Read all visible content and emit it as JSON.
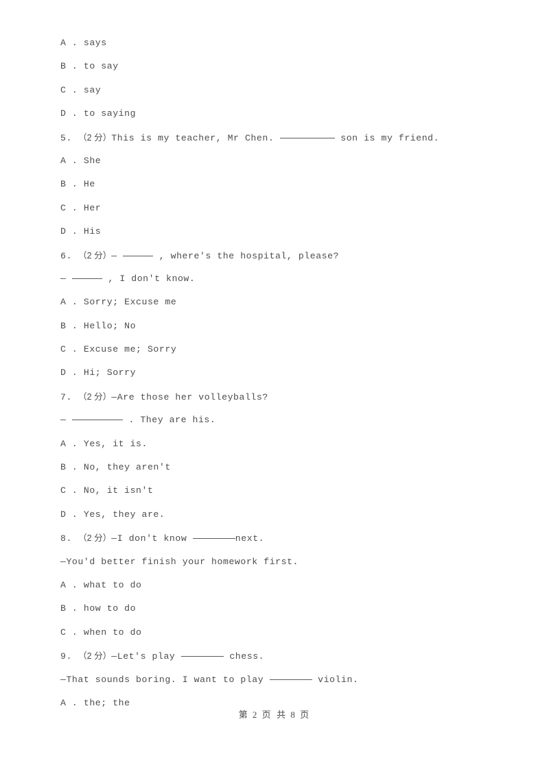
{
  "document": {
    "type": "exam-paper",
    "language": "en-with-zh-annotations",
    "background_color": "#ffffff",
    "text_color": "#4d4d4d"
  },
  "footer": {
    "prefix": "第",
    "page_number": "2",
    "middle": "页 共",
    "total_pages": "8",
    "suffix": "页",
    "full_text": "第 2 页 共 8 页"
  },
  "lines": [
    {
      "id": "q4-opt-a",
      "kind": "option",
      "letter": "A",
      "separator": ".",
      "text": "says"
    },
    {
      "id": "q4-opt-b",
      "kind": "option",
      "letter": "B",
      "separator": ".",
      "text": "to say"
    },
    {
      "id": "q4-opt-c",
      "kind": "option",
      "letter": "C",
      "separator": ".",
      "text": "say"
    },
    {
      "id": "q4-opt-d",
      "kind": "option",
      "letter": "D",
      "separator": ".",
      "text": "to saying"
    },
    {
      "id": "q5-stem",
      "kind": "question",
      "number": "5.",
      "score": "（2 分）",
      "before": "This is my teacher, Mr Chen.",
      "blank": "w-xlong",
      "after": "son is my friend."
    },
    {
      "id": "q5-opt-a",
      "kind": "option",
      "letter": "A",
      "separator": ".",
      "text": "She"
    },
    {
      "id": "q5-opt-b",
      "kind": "option",
      "letter": "B",
      "separator": ".",
      "text": "He"
    },
    {
      "id": "q5-opt-c",
      "kind": "option",
      "letter": "C",
      "separator": ".",
      "text": "Her"
    },
    {
      "id": "q5-opt-d",
      "kind": "option",
      "letter": "D",
      "separator": ".",
      "text": "His"
    },
    {
      "id": "q6-stem",
      "kind": "question",
      "number": "6.",
      "score": "（2 分）",
      "before": "—",
      "blank": "w-short",
      "after": ", where's the hospital, please?"
    },
    {
      "id": "q6-stem-2",
      "kind": "continuation",
      "before": "—",
      "blank": "w-short",
      "after": ", I don't know."
    },
    {
      "id": "q6-opt-a",
      "kind": "option",
      "letter": "A",
      "separator": ".",
      "text": "Sorry; Excuse me"
    },
    {
      "id": "q6-opt-b",
      "kind": "option",
      "letter": "B",
      "separator": ".",
      "text": "Hello; No"
    },
    {
      "id": "q6-opt-c",
      "kind": "option",
      "letter": "C",
      "separator": ".",
      "text": "Excuse me; Sorry"
    },
    {
      "id": "q6-opt-d",
      "kind": "option",
      "letter": "D",
      "separator": ".",
      "text": "Hi; Sorry"
    },
    {
      "id": "q7-stem",
      "kind": "question",
      "number": "7.",
      "score": "（2 分）",
      "before": "—Are those her volleyballs?",
      "blank": null,
      "after": ""
    },
    {
      "id": "q7-stem-2",
      "kind": "continuation",
      "before": "—",
      "blank": "w-long",
      "after": ". They are his."
    },
    {
      "id": "q7-opt-a",
      "kind": "option",
      "letter": "A",
      "separator": ".",
      "text": "Yes, it is."
    },
    {
      "id": "q7-opt-b",
      "kind": "option",
      "letter": "B",
      "separator": ".",
      "text": "No, they aren't"
    },
    {
      "id": "q7-opt-c",
      "kind": "option",
      "letter": "C",
      "separator": ".",
      "text": "No, it isn't"
    },
    {
      "id": "q7-opt-d",
      "kind": "option",
      "letter": "D",
      "separator": ".",
      "text": "Yes, they are."
    },
    {
      "id": "q8-stem",
      "kind": "question",
      "number": "8.",
      "score": "（2 分）",
      "before": "—I don't know",
      "blank": "w-mid",
      "after": "next."
    },
    {
      "id": "q8-stem-2",
      "kind": "continuation",
      "before": "—You'd better finish your homework first.",
      "blank": null,
      "after": ""
    },
    {
      "id": "q8-opt-a",
      "kind": "option",
      "letter": "A",
      "separator": ".",
      "text": "what to do"
    },
    {
      "id": "q8-opt-b",
      "kind": "option",
      "letter": "B",
      "separator": ".",
      "text": "how to do"
    },
    {
      "id": "q8-opt-c",
      "kind": "option",
      "letter": "C",
      "separator": ".",
      "text": "when to do"
    },
    {
      "id": "q9-stem",
      "kind": "question",
      "number": "9.",
      "score": "（2 分）",
      "before": "—Let's play",
      "blank": "w-mid",
      "after": "chess."
    },
    {
      "id": "q9-stem-2",
      "kind": "continuation",
      "before": "—That sounds boring. I want to play",
      "blank": "w-mid",
      "after": "violin."
    },
    {
      "id": "q9-opt-a",
      "kind": "option",
      "letter": "A",
      "separator": ".",
      "text": "the; the"
    }
  ]
}
